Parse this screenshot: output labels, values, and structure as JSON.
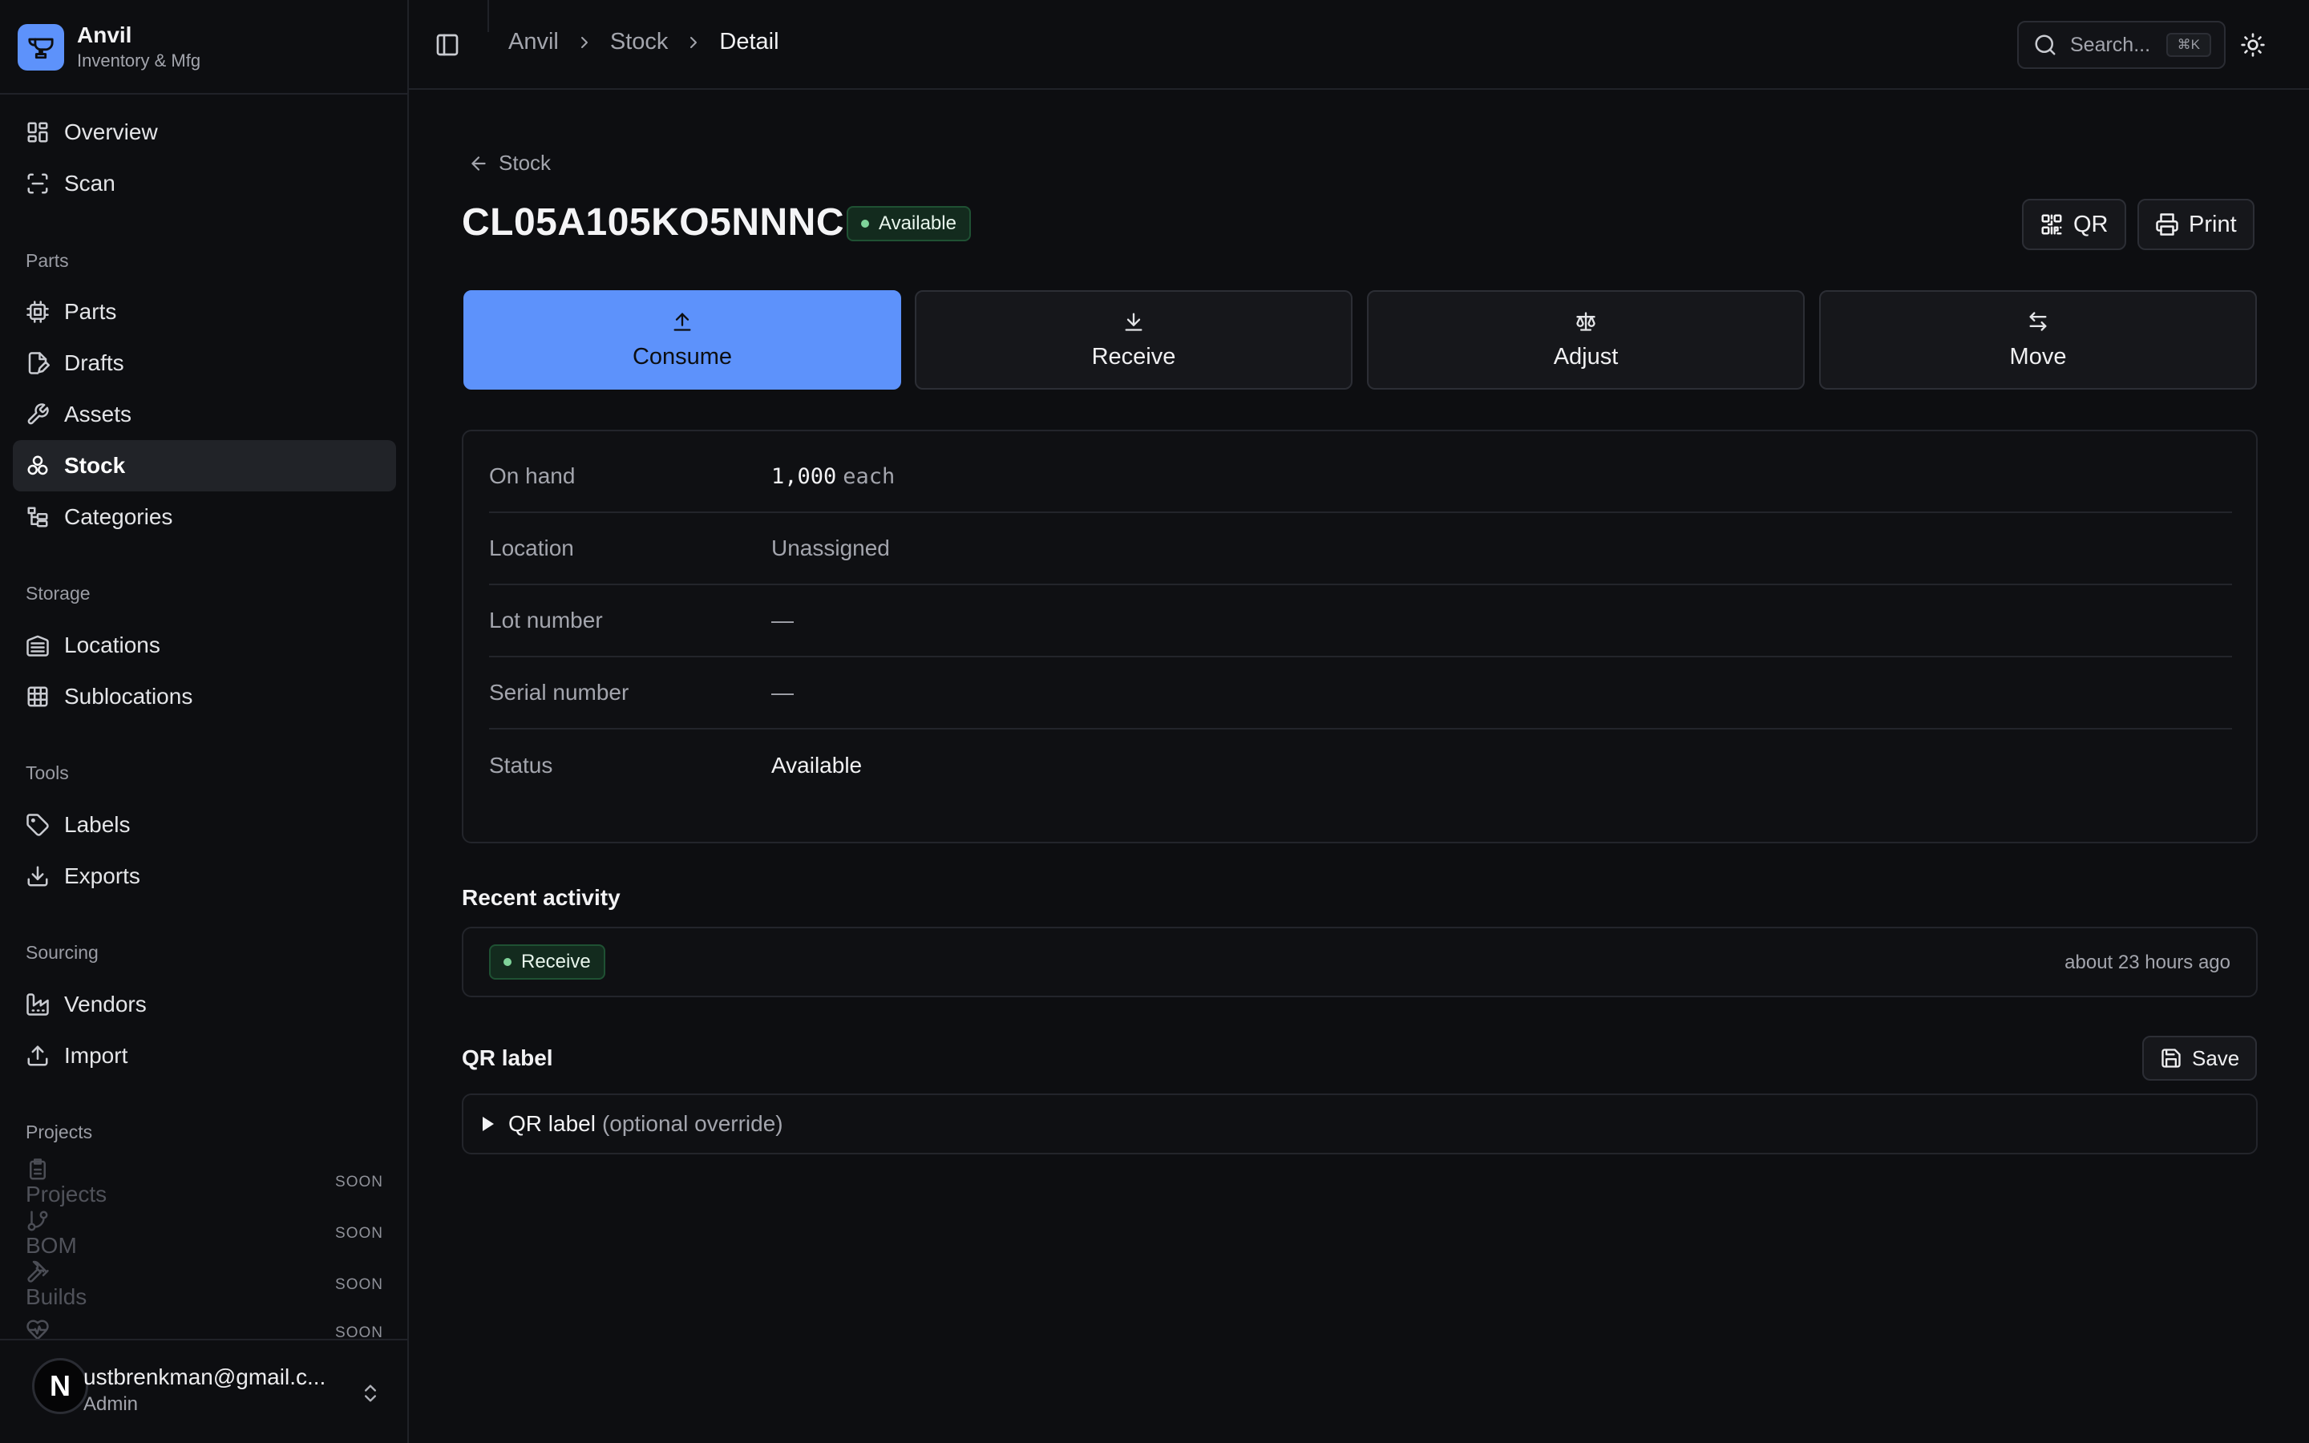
{
  "brand": {
    "name": "Anvil",
    "subtitle": "Inventory & Mfg"
  },
  "nav": {
    "overview": "Overview",
    "scan": "Scan",
    "section_parts": "Parts",
    "parts": "Parts",
    "drafts": "Drafts",
    "assets": "Assets",
    "stock": "Stock",
    "categories": "Categories",
    "section_storage": "Storage",
    "locations": "Locations",
    "sublocations": "Sublocations",
    "section_tools": "Tools",
    "labels": "Labels",
    "exports": "Exports",
    "section_sourcing": "Sourcing",
    "vendors": "Vendors",
    "import": "Import",
    "section_projects": "Projects",
    "soon_items": [
      {
        "label": "Projects",
        "badge": "SOON"
      },
      {
        "label": "BOM",
        "badge": "SOON"
      },
      {
        "label": "Builds",
        "badge": "SOON"
      },
      {
        "label": "",
        "badge": "SOON"
      }
    ]
  },
  "user": {
    "initial": "N",
    "email": "ustbrenkman@gmail.c...",
    "role": "Admin"
  },
  "header": {
    "breadcrumb": [
      "Anvil",
      "Stock",
      "Detail"
    ],
    "search_placeholder": "Search...",
    "search_shortcut": "⌘K"
  },
  "page": {
    "back_label": "Stock",
    "title": "CL05A105KO5NNNC",
    "status": "Available",
    "qr_button": "QR",
    "print_button": "Print",
    "actions": [
      "Consume",
      "Receive",
      "Adjust",
      "Move"
    ]
  },
  "details": {
    "on_hand_label": "On hand",
    "on_hand_qty": "1,000",
    "on_hand_unit": "each",
    "location_label": "Location",
    "location_value": "Unassigned",
    "lot_label": "Lot number",
    "lot_value": "—",
    "serial_label": "Serial number",
    "serial_value": "—",
    "status_label": "Status",
    "status_value": "Available"
  },
  "activity": {
    "title": "Recent activity",
    "items": [
      {
        "type": "Receive",
        "time": "about 23 hours ago"
      }
    ]
  },
  "qr_label": {
    "title": "QR label",
    "save_button": "Save",
    "summary": "QR label",
    "hint": "(optional override)"
  },
  "colors": {
    "background": "#0d0e11",
    "accent": "#5d92fb",
    "success_bg": "#132b1e",
    "success_dot": "#7fd39a"
  }
}
